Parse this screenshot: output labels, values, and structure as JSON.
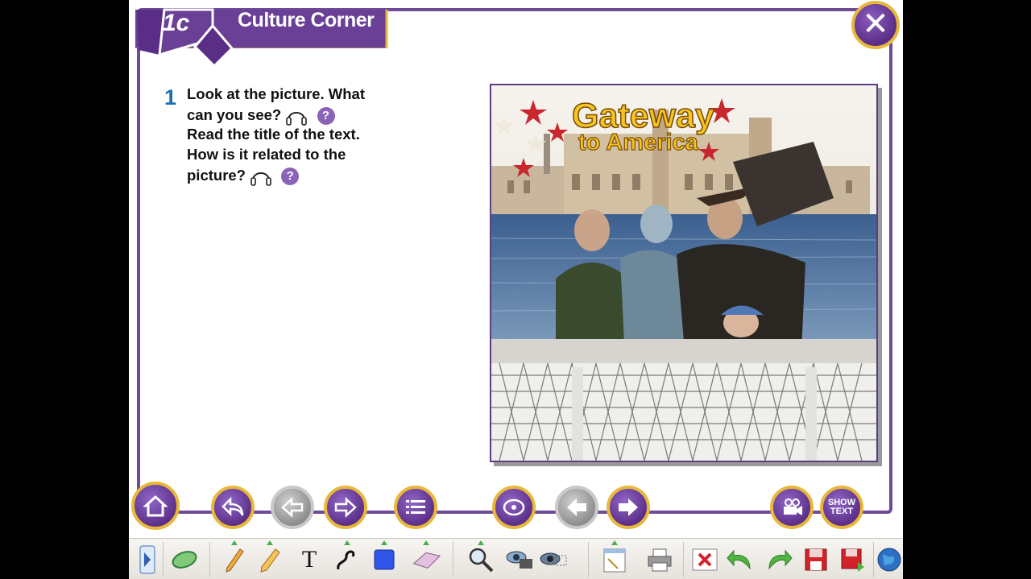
{
  "header": {
    "unit": "1c",
    "title": "Culture Corner"
  },
  "exercise": {
    "number": "1",
    "lines": [
      "Look at the picture. What",
      "can you see?",
      "Read the title of the text.",
      "How is it related to the",
      "picture?"
    ],
    "help_symbol": "?"
  },
  "picture": {
    "title_line1": "Gateway",
    "title_line2": "to America"
  },
  "nav": {
    "home": "home-icon",
    "back": "return-icon",
    "prev": "arrow-left-icon",
    "next": "arrow-right-icon",
    "menu": "list-icon",
    "audio": "audio-cd-icon",
    "page_prev": "arrow-left-icon",
    "page_next": "arrow-right-icon",
    "video": "video-camera-icon",
    "show_text_line1": "SHOW",
    "show_text_line2": "TEXT"
  },
  "toolbar": {
    "icons": [
      "expand-arrow-icon",
      "mouse-icon",
      "pencil-icon",
      "highlighter-icon",
      "text-tool-icon",
      "freehand-icon",
      "shape-icon",
      "eraser-icon",
      "magnifier-icon",
      "spotlight-icon",
      "reveal-icon",
      "new-page-icon",
      "print-icon",
      "clear-icon",
      "undo-icon",
      "redo-icon",
      "save-icon",
      "save-as-icon",
      "globe-icon"
    ],
    "text_tool_label": "T"
  },
  "colors": {
    "purple": "#6e4a97",
    "gold": "#e8b83b",
    "blue": "#1a6fb5"
  }
}
